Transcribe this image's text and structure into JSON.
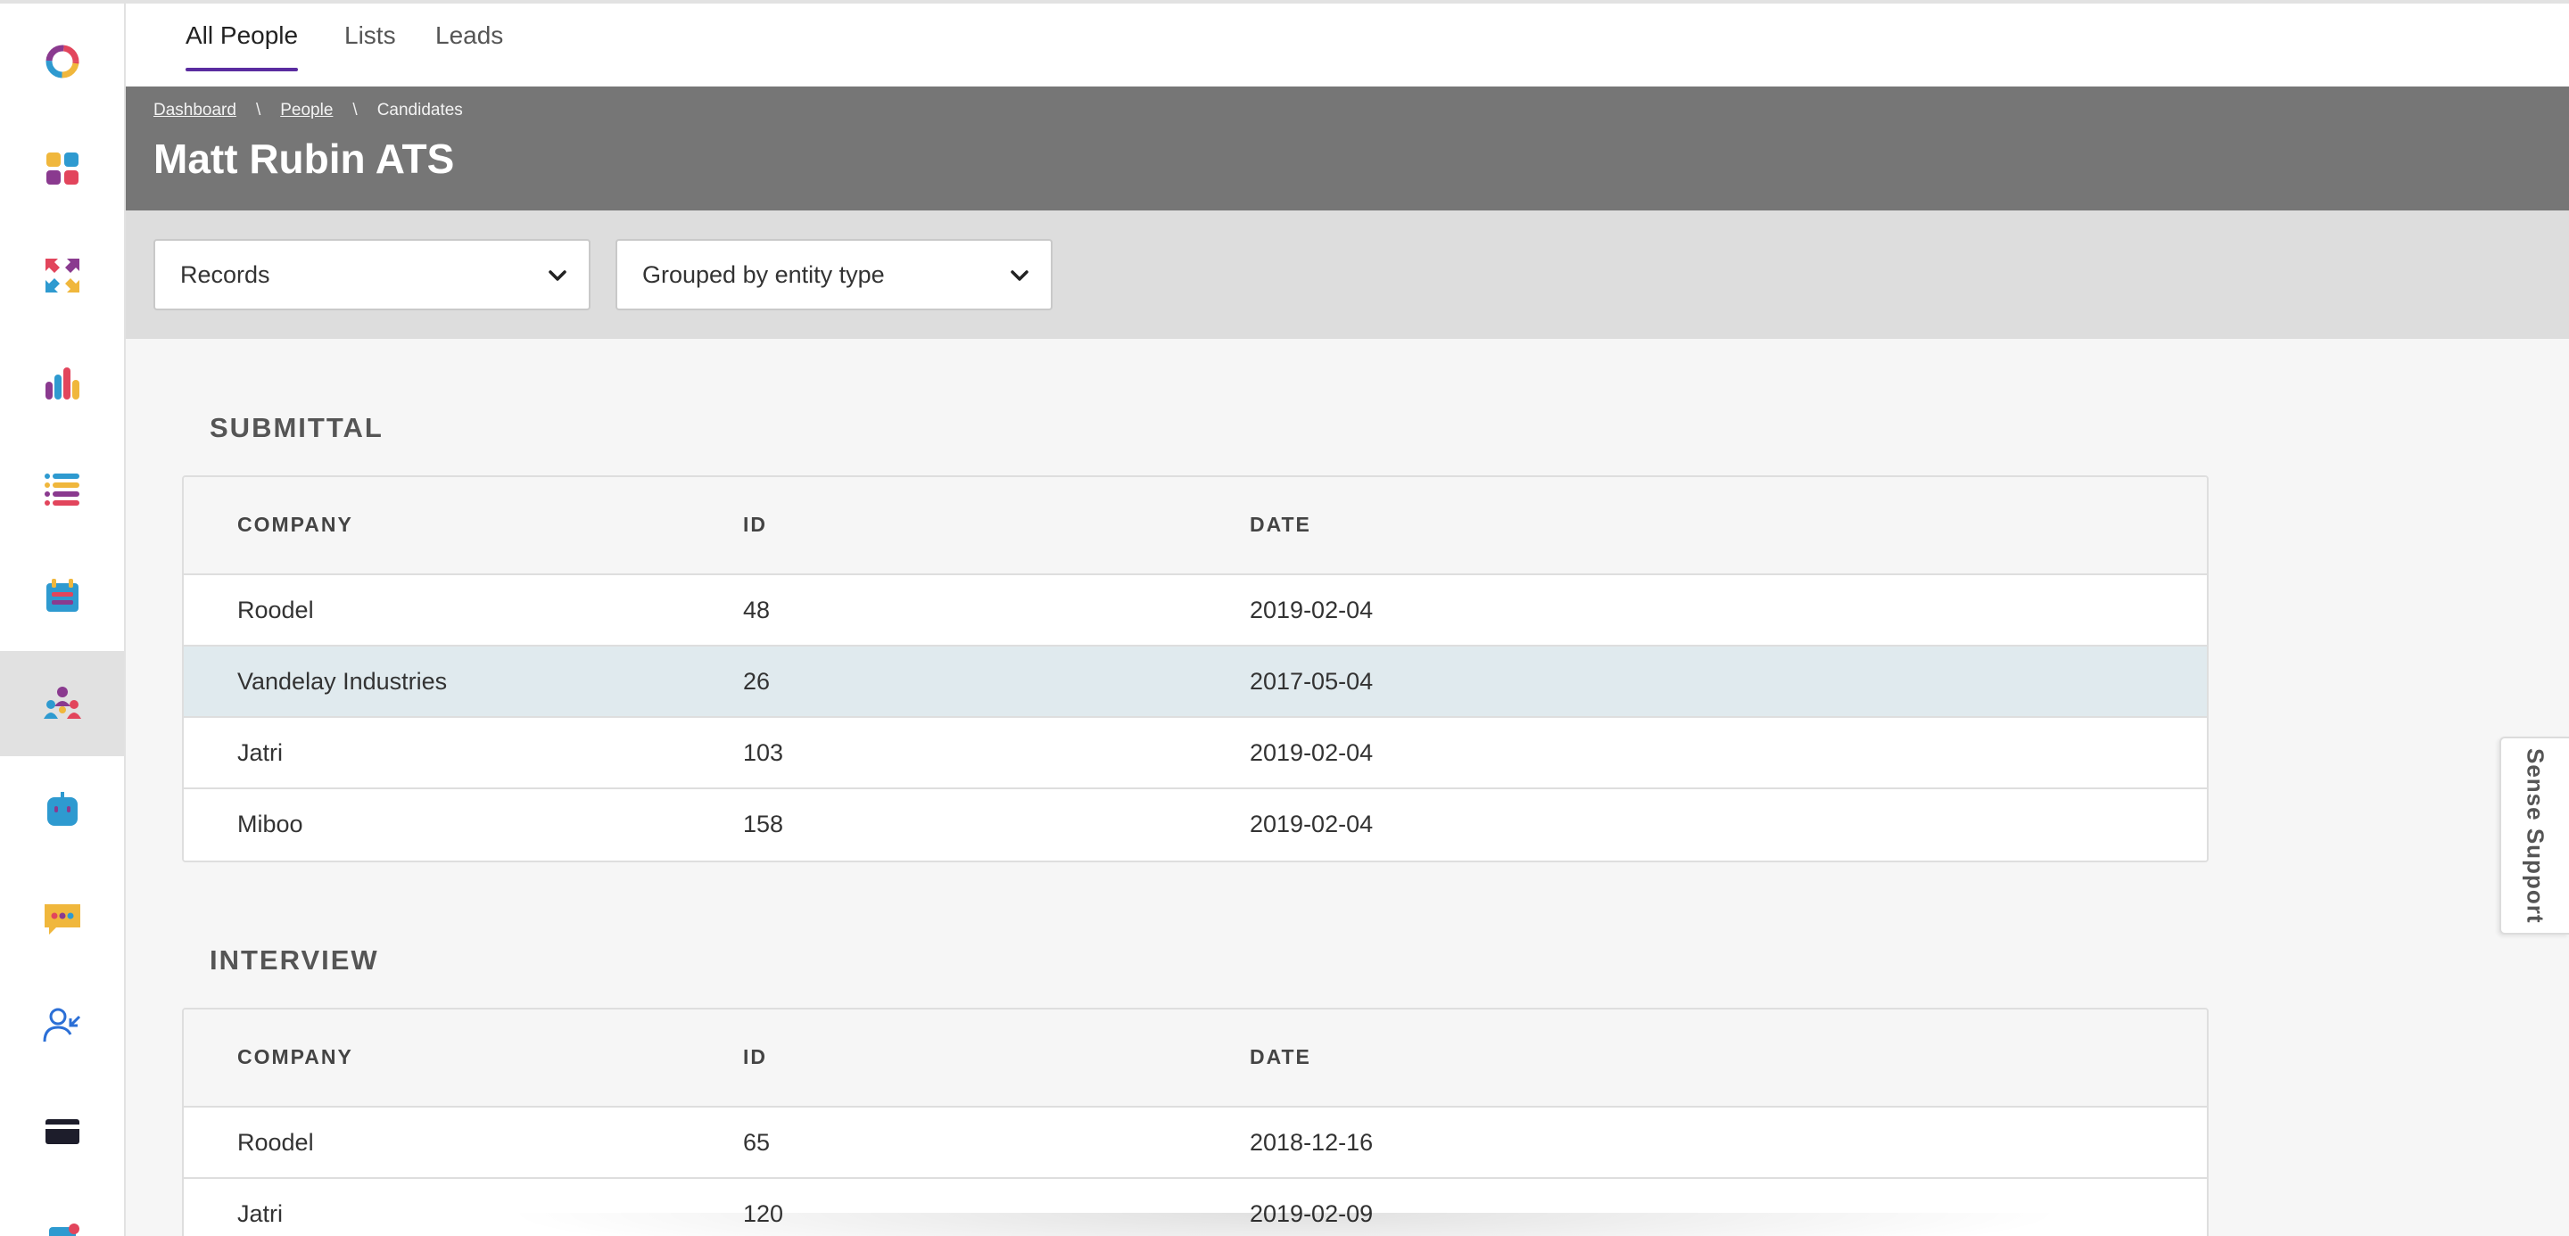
{
  "tabs": [
    {
      "label": "All People",
      "active": true
    },
    {
      "label": "Lists",
      "active": false
    },
    {
      "label": "Leads",
      "active": false
    }
  ],
  "breadcrumb": {
    "items": [
      "Dashboard",
      "People",
      "Candidates"
    ],
    "separator": "\\"
  },
  "page_title": "Matt Rubin ATS",
  "filters": {
    "records_select": "Records",
    "group_select": "Grouped by entity type"
  },
  "sidebar": {
    "items": [
      {
        "icon": "logo-ring-icon"
      },
      {
        "icon": "dashboard-grid-icon"
      },
      {
        "icon": "arrows-icon"
      },
      {
        "icon": "bar-chart-icon"
      },
      {
        "icon": "list-icon"
      },
      {
        "icon": "calendar-icon"
      },
      {
        "icon": "people-icon",
        "active": true
      },
      {
        "icon": "robot-icon"
      },
      {
        "icon": "chat-icon"
      },
      {
        "icon": "user-add-icon"
      },
      {
        "icon": "card-icon"
      },
      {
        "icon": "puzzle-icon"
      }
    ]
  },
  "sections": [
    {
      "title": "SUBMITTAL",
      "columns": [
        "COMPANY",
        "ID",
        "DATE"
      ],
      "rows": [
        {
          "company": "Roodel",
          "id": "48",
          "date": "2019-02-04"
        },
        {
          "company": "Vandelay Industries",
          "id": "26",
          "date": "2017-05-04",
          "highlighted": true
        },
        {
          "company": "Jatri",
          "id": "103",
          "date": "2019-02-04"
        },
        {
          "company": "Miboo",
          "id": "158",
          "date": "2019-02-04"
        }
      ]
    },
    {
      "title": "INTERVIEW",
      "columns": [
        "COMPANY",
        "ID",
        "DATE"
      ],
      "rows": [
        {
          "company": "Roodel",
          "id": "65",
          "date": "2018-12-16"
        },
        {
          "company": "Jatri",
          "id": "120",
          "date": "2019-02-09"
        }
      ]
    }
  ],
  "support_tab": "Sense Support",
  "colors": {
    "accent": "#5a2ca0",
    "header_bg": "#767676",
    "filter_bg": "#dddddd",
    "row_highlight": "#e0eaee"
  }
}
